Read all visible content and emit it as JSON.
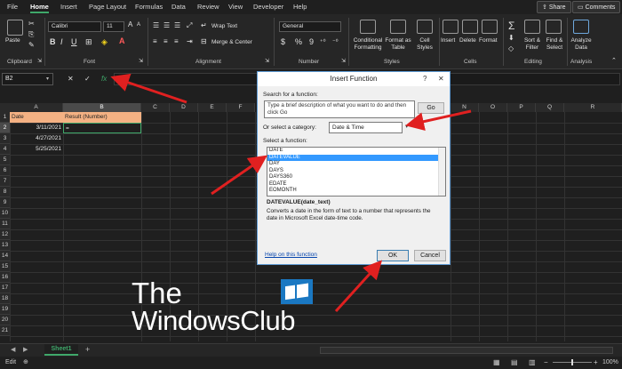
{
  "menu": {
    "tabs": [
      "File",
      "Home",
      "Insert",
      "Page Layout",
      "Formulas",
      "Data",
      "Review",
      "View",
      "Developer",
      "Help"
    ],
    "share": "Share",
    "comments": "Comments"
  },
  "ribbon": {
    "clipboard": {
      "paste": "Paste",
      "label": "Clipboard"
    },
    "font": {
      "name": "Calibri",
      "size": "11",
      "label": "Font",
      "bold": "B",
      "italic": "I",
      "underline": "U"
    },
    "alignment": {
      "wrap_text": "Wrap Text",
      "merge_center": "Merge & Center",
      "label": "Alignment"
    },
    "number": {
      "format": "General",
      "label": "Number",
      "dollar": "$",
      "percent": "%",
      "comma": "9"
    },
    "styles": {
      "conditional": "Conditional Formatting",
      "format_table": "Format as Table",
      "cell_styles": "Cell Styles",
      "label": "Styles"
    },
    "cells": {
      "insert": "Insert",
      "delete": "Delete",
      "format": "Format",
      "label": "Cells"
    },
    "editing": {
      "sort_filter": "Sort & Filter",
      "find_select": "Find & Select",
      "label": "Editing"
    },
    "analysis": {
      "analyze": "Analyze Data",
      "label": "Analysis"
    }
  },
  "formula_bar": {
    "name_box": "B2",
    "cancel": "✕",
    "enter": "✓",
    "fx": "fx"
  },
  "grid": {
    "columns": [
      "A",
      "B",
      "C",
      "D",
      "E",
      "F",
      "G",
      "H",
      "I",
      "J",
      "K",
      "L",
      "M",
      "N",
      "O",
      "P",
      "Q",
      "R"
    ],
    "rows": [
      "1",
      "2",
      "3",
      "4",
      "5",
      "6",
      "7",
      "8",
      "9",
      "10",
      "11",
      "12",
      "13",
      "14",
      "15",
      "16",
      "17",
      "18",
      "19",
      "20",
      "21"
    ],
    "header_a": "Date",
    "header_b": "Result (Number)",
    "dates": [
      "3/11/2021",
      "4/27/2021",
      "5/25/2021"
    ],
    "active_cell_value": "="
  },
  "dialog": {
    "title": "Insert Function",
    "help_glyph": "?",
    "close_glyph": "✕",
    "search_label": "Search for a function:",
    "search_placeholder": "Type a brief description of what you want to do and then click Go",
    "go": "Go",
    "category_label": "Or select a category:",
    "category_value": "Date & Time",
    "select_label": "Select a function:",
    "functions": [
      "DATE",
      "DATEVALUE",
      "DAY",
      "DAYS",
      "DAYS360",
      "EDATE",
      "EOMONTH"
    ],
    "selected_function": "DATEVALUE",
    "signature": "DATEVALUE(date_text)",
    "description": "Converts a date in the form of text to a number that represents the date in Microsoft Excel date-time code.",
    "help_link": "Help on this function",
    "ok": "OK",
    "cancel": "Cancel"
  },
  "sheets": {
    "active": "Sheet1",
    "add": "+"
  },
  "status": {
    "mode": "Edit",
    "zoom": "100%"
  },
  "watermark": {
    "line1": "The",
    "line2": "WindowsClub"
  },
  "colors": {
    "accent_green": "#3fa86a",
    "header_orange": "#f4b183",
    "selection_blue": "#3399ff",
    "arrow_red": "#e02020"
  }
}
